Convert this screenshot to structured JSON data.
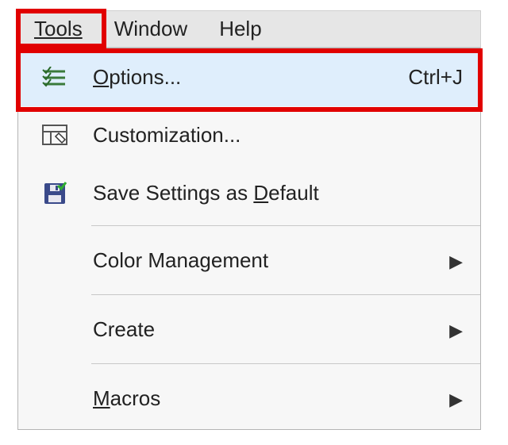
{
  "menubar": {
    "tools": "Tools",
    "window": "Window",
    "help": "Help"
  },
  "menu": {
    "options": {
      "label": "Options...",
      "shortcut": "Ctrl+J",
      "mnemonic": "O"
    },
    "customization": {
      "label": "Customization...",
      "mnemonic": ""
    },
    "save_default": {
      "label": "Save Settings as Default",
      "mnemonic": "D"
    },
    "color_mgmt": {
      "label": "Color Management",
      "mnemonic": ""
    },
    "create": {
      "label": "Create",
      "mnemonic": ""
    },
    "macros": {
      "label": "Macros",
      "mnemonic": "M"
    }
  }
}
